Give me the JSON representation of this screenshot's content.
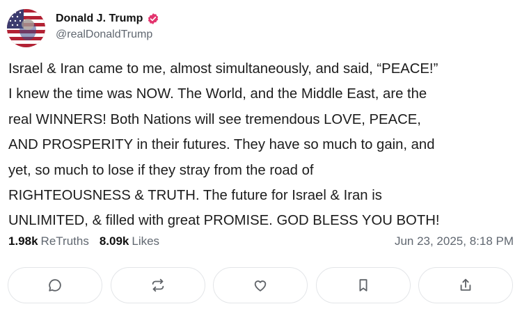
{
  "author": {
    "display_name": "Donald J. Trump",
    "handle": "@realDonaldTrump",
    "verified_color": "#e3346e"
  },
  "post": {
    "text": "Israel & Iran came to me, almost simultaneously, and said, “PEACE!”\nI knew the time was NOW. The World, and the Middle East, are the\nreal WINNERS! Both Nations will see tremendous LOVE, PEACE,\nAND PROSPERITY in their futures. They have so much to gain, and\nyet, so much to lose if they stray from the road of\nRIGHTEOUSNESS & TRUTH. The future for Israel & Iran is\nUNLIMITED, & filled with great PROMISE. GOD BLESS YOU BOTH!"
  },
  "stats": {
    "retruths_count": "1.98k",
    "retruths_label": "ReTruths",
    "likes_count": "8.09k",
    "likes_label": "Likes",
    "timestamp": "Jun 23, 2025, 8:18 PM"
  },
  "actions": [
    {
      "icon": "reply-icon"
    },
    {
      "icon": "retruth-icon"
    },
    {
      "icon": "like-icon"
    },
    {
      "icon": "bookmark-icon"
    },
    {
      "icon": "share-icon"
    }
  ],
  "colors": {
    "icon_gray": "#5f6368",
    "muted_text": "#606770",
    "border": "#e3e5e8"
  }
}
